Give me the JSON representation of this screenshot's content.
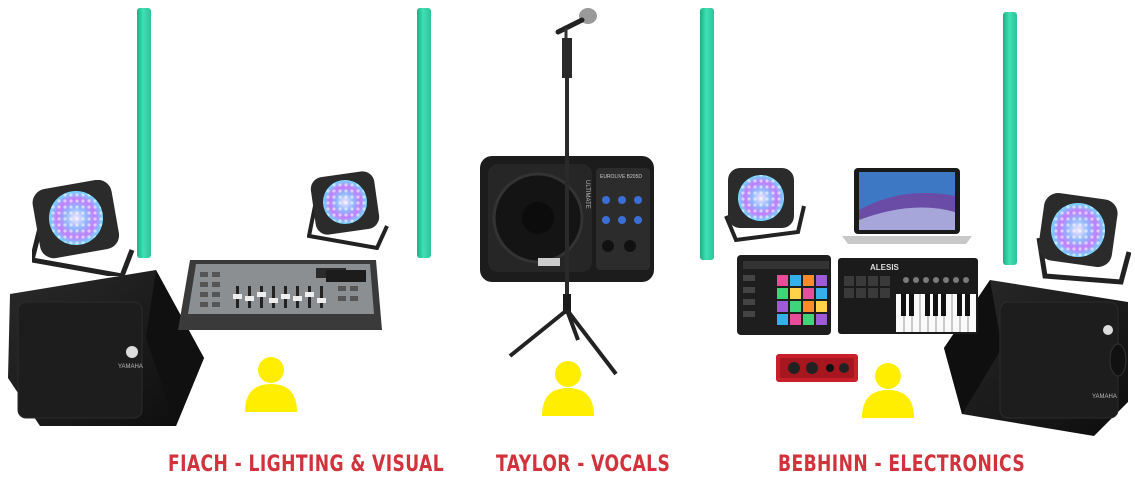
{
  "diagram_title": "",
  "positions": [
    {
      "name": "FIACH - LIGHTING & VISUAL"
    },
    {
      "name": "TAYLOR - VOCALS"
    },
    {
      "name": "BEBHINN - ELECTRONICS"
    }
  ],
  "equipment_text": {
    "stage_monitor_brand": "YAMAHA",
    "keyboard_brand": "ALESIS",
    "powered_monitor_model": "EUROLIVE B205D",
    "powered_monitor_brand": "ULTIMATE"
  },
  "colors": {
    "label": "#d1323b",
    "person": "#ffee00",
    "led_tube": "#3fe0b4",
    "speaker": "#1b1b1b"
  },
  "icons": [
    "led-tube-icon",
    "led-par-light-icon",
    "stage-monitor-speaker-icon",
    "dmx-controller-icon",
    "microphone-stand-icon",
    "powered-monitor-icon",
    "laptop-icon",
    "drum-pad-controller-icon",
    "midi-keyboard-icon",
    "audio-interface-icon",
    "person-icon"
  ]
}
